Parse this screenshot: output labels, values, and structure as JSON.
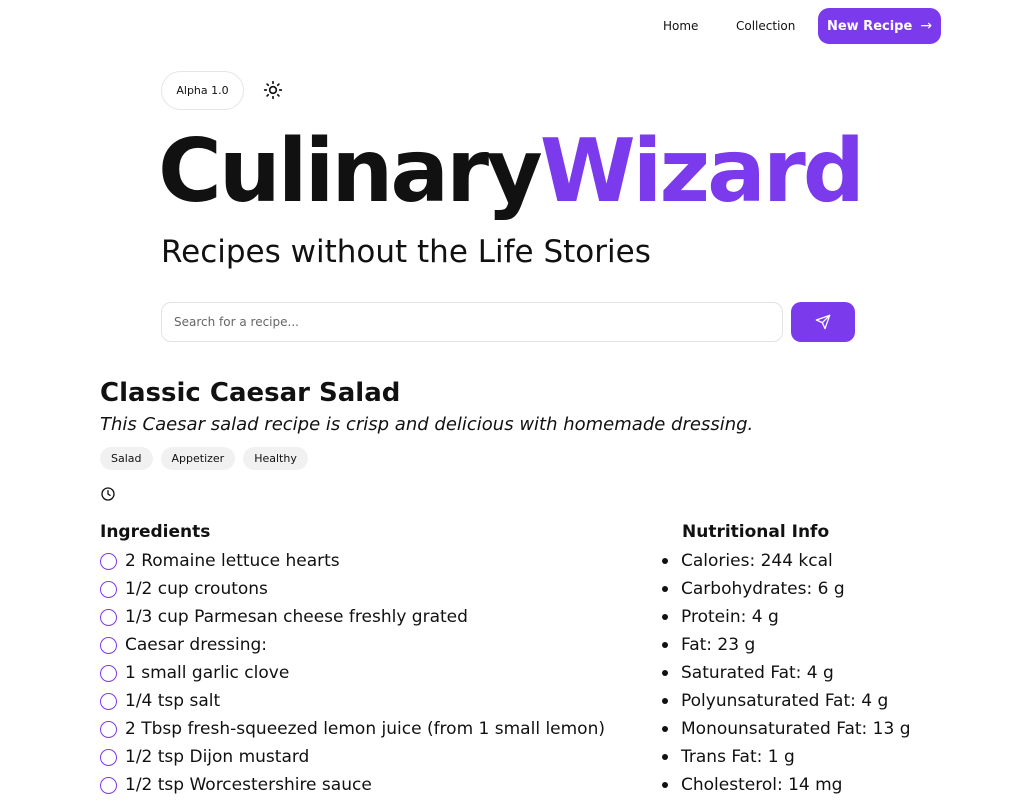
{
  "nav": {
    "home": "Home",
    "collection": "Collection",
    "new_recipe": "New Recipe",
    "new_recipe_icon": "arrow-right-icon"
  },
  "header": {
    "version": "Alpha 1.0",
    "theme_icon": "sun-icon",
    "title_part1": "Culinary",
    "title_part2": "Wizard",
    "subtitle": "Recipes without the Life Stories"
  },
  "search": {
    "placeholder": "Search for a recipe...",
    "value": "",
    "submit_icon": "send-icon"
  },
  "recipe": {
    "title": "Classic Caesar Salad",
    "description": "This Caesar salad recipe is crisp and delicious with homemade dressing.",
    "tags": [
      "Salad",
      "Appetizer",
      "Healthy"
    ],
    "time_icon": "clock-icon",
    "ingredients_heading": "Ingredients",
    "ingredients": [
      "2 Romaine lettuce hearts",
      "1/2 cup croutons",
      "1/3 cup Parmesan cheese freshly grated",
      "Caesar dressing:",
      "1 small garlic clove",
      "1/4 tsp salt",
      "2 Tbsp fresh-squeezed lemon juice (from 1 small lemon)",
      "1/2 tsp Dijon mustard",
      "1/2 tsp Worcestershire sauce"
    ],
    "nutrition_heading": "Nutritional Info",
    "nutrition": [
      "Calories: 244 kcal",
      "Carbohydrates: 6 g",
      "Protein: 4 g",
      "Fat: 23 g",
      "Saturated Fat: 4 g",
      "Polyunsaturated Fat: 4 g",
      "Monounsaturated Fat: 13 g",
      "Trans Fat: 1 g",
      "Cholesterol: 14 mg"
    ]
  },
  "colors": {
    "accent": "#7c3aed",
    "text": "#111111",
    "tag_bg": "#f1f1f1",
    "border": "#e2e2e2"
  }
}
